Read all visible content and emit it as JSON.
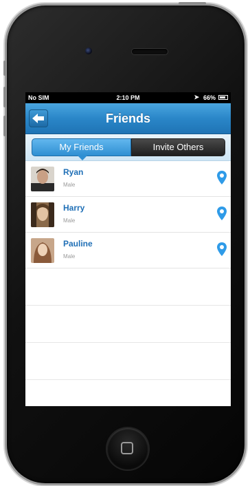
{
  "status_bar": {
    "carrier": "No SIM",
    "time": "2:10 PM",
    "battery": "66%"
  },
  "nav": {
    "title": "Friends"
  },
  "segments": {
    "my_friends": "My Friends",
    "invite_others": "Invite Others"
  },
  "friends": [
    {
      "name": "Ryan",
      "gender": "Male"
    },
    {
      "name": "Harry",
      "gender": "Male"
    },
    {
      "name": "Pauline",
      "gender": "Male"
    }
  ],
  "colors": {
    "accent": "#2a86c8",
    "name_text": "#1f6fb6",
    "pin": "#2f9be8"
  }
}
